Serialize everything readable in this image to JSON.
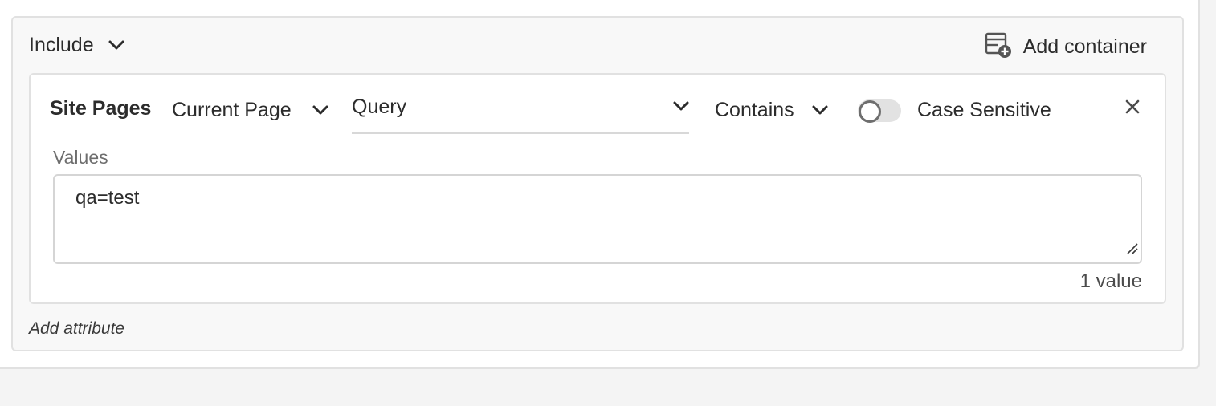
{
  "container": {
    "include_label": "Include",
    "add_container_label": "Add container"
  },
  "rule": {
    "attribute_name": "Site Pages",
    "scope_label": "Current Page",
    "field_label": "Query",
    "operator_label": "Contains",
    "case_sensitive_label": "Case Sensitive",
    "case_sensitive_on": false,
    "values_label": "Values",
    "values_text": "qa=test",
    "value_count_label": "1 value"
  },
  "footer": {
    "add_attribute_label": "Add attribute"
  },
  "icons": {
    "chevron": "chevron-down-icon",
    "add_container": "add-container-icon",
    "close": "close-icon",
    "resize": "resize-handle-icon"
  },
  "colors": {
    "text": "#2c2c2c",
    "muted": "#6e6e6e",
    "border": "#e1e1e1",
    "toggle_track": "#e2e2e2"
  }
}
